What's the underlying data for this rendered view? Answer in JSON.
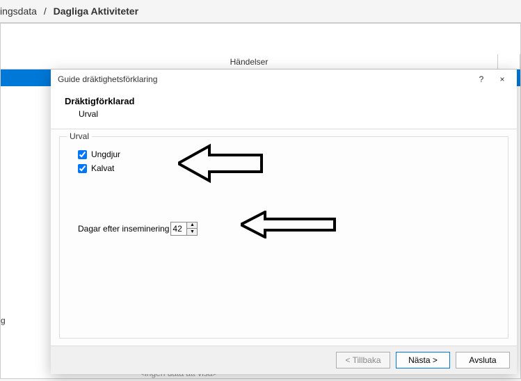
{
  "breadcrumb": {
    "prev": "ingsdata",
    "sep": "/",
    "current": "Dagliga Aktiviteter"
  },
  "background": {
    "column_header": "Händelser",
    "side_label": "g",
    "footer_placeholder": "<ingen data att visa>"
  },
  "dialog": {
    "title": "Guide dräktighetsförklaring",
    "help_symbol": "?",
    "close_symbol": "×",
    "header_title": "Dräktigförklarad",
    "header_sub": "Urval",
    "group_title": "Urval",
    "checkbox_ungdjur": "Ungdjur",
    "checkbox_ungdjur_checked": true,
    "checkbox_kalvat": "Kalvat",
    "checkbox_kalvat_checked": true,
    "days_label": "Dagar efter inseminering",
    "days_value": "42",
    "btn_back": "< Tillbaka",
    "btn_next": "Nästa >",
    "btn_finish": "Avsluta"
  }
}
